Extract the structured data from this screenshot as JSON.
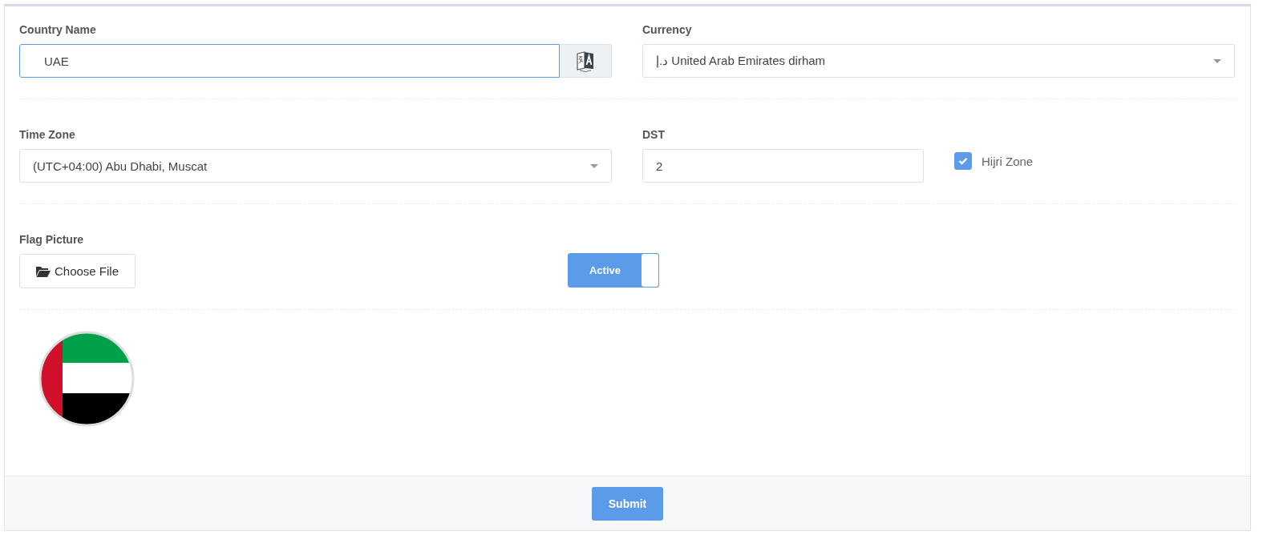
{
  "country_name": {
    "label": "Country Name",
    "value": "UAE"
  },
  "currency": {
    "label": "Currency",
    "value": "د.إ United Arab Emirates dirham"
  },
  "time_zone": {
    "label": "Time Zone",
    "value": "(UTC+04:00) Abu Dhabi, Muscat"
  },
  "dst": {
    "label": "DST",
    "value": "2"
  },
  "hijri_zone": {
    "label": "Hijri Zone",
    "checked": true
  },
  "flag_picture": {
    "label": "Flag Picture",
    "button": "Choose File"
  },
  "active_toggle": {
    "label": "Active",
    "on": true
  },
  "submit": "Submit"
}
